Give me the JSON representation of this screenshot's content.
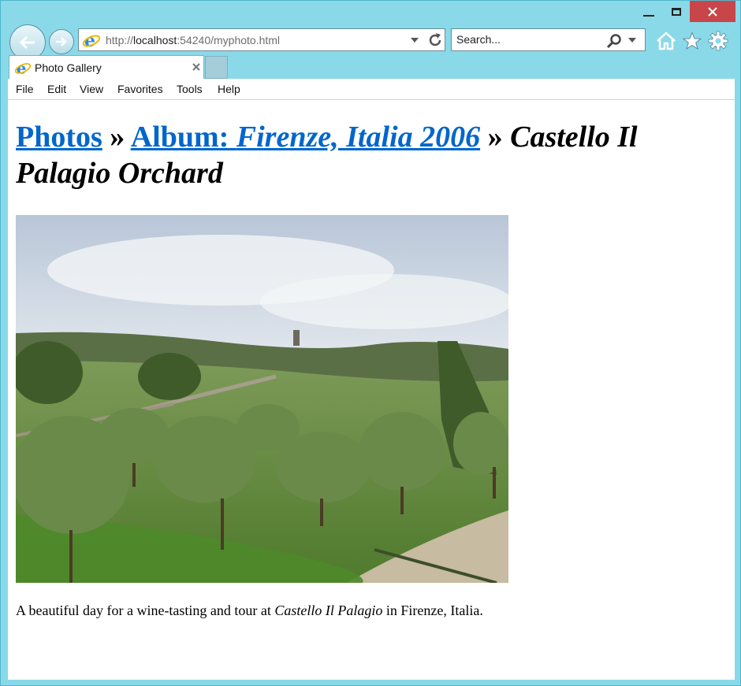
{
  "browser": {
    "address_url_prefix": "http://",
    "address_url_host": "localhost",
    "address_url_rest": ":54240/myphoto.html",
    "search_placeholder": "Search...",
    "tab_title": "Photo Gallery",
    "menu": [
      "File",
      "Edit",
      "View",
      "Favorites",
      "Tools",
      "Help"
    ],
    "frame_color": "#8ad9e9",
    "close_color": "#c8464a"
  },
  "page": {
    "breadcrumb_photos": "Photos",
    "separator": "»",
    "breadcrumb_album_prefix": "Album: ",
    "breadcrumb_album_name": "Firenze, Italia 2006",
    "current_title": "Castello Il Palagio Orchard",
    "caption_before": "A beautiful day for a wine-tasting and tour at ",
    "caption_emphasis": "Castello Il Palagio",
    "caption_after": " in Firenze, Italia.",
    "link_color": "#0066cc"
  }
}
